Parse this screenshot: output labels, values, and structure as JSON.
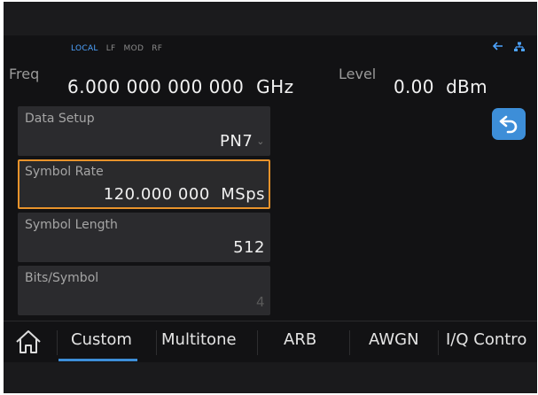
{
  "status": {
    "items": [
      "LOCAL",
      "LF",
      "MOD",
      "RF"
    ]
  },
  "header": {
    "freq_label": "Freq",
    "freq_value": "6.000 000 000 000",
    "freq_unit": "GHz",
    "level_label": "Level",
    "level_value": "0.00",
    "level_unit": "dBm"
  },
  "params": [
    {
      "label": "Data Setup",
      "value": "PN7"
    },
    {
      "label": "Symbol Rate",
      "value": "120.000 000",
      "unit": "MSps"
    },
    {
      "label": "Symbol Length",
      "value": "512"
    },
    {
      "label": "Bits/Symbol",
      "value": "4"
    }
  ],
  "nav": {
    "tabs": [
      "Custom",
      "Multitone",
      "ARB",
      "AWGN",
      "I/Q Contro"
    ]
  },
  "colors": {
    "accent": "#3d8ed8",
    "selection": "#e8932b",
    "local": "#4da3ff",
    "background": "#121214"
  },
  "icons": [
    "arrow-left-icon",
    "network-icon",
    "back-icon",
    "home-icon",
    "chevron-down-icon"
  ]
}
